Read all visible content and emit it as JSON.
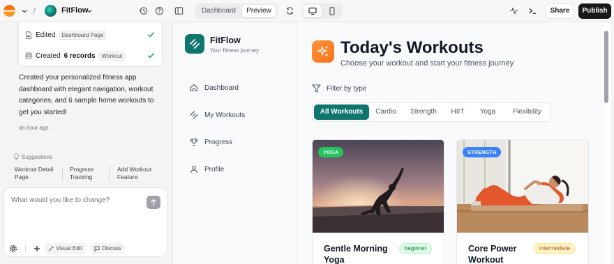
{
  "topbar": {
    "project_name": "FitFlow",
    "view_tabs": [
      "Dashboard",
      "Preview"
    ],
    "active_view": "Preview",
    "share_label": "Share",
    "publish_label": "Publish"
  },
  "chat": {
    "tasks": [
      {
        "verb": "Edited",
        "bold": "",
        "tag": "Dashboard Page"
      },
      {
        "verb": "Created",
        "bold": "6 records",
        "tag": "Workout"
      }
    ],
    "message": "Created your personalized fitness app dashboard with elegant navigation, workout categories, and 6 sample home workouts to get you started!",
    "time": "an hour ago",
    "suggestions_label": "Suggestions",
    "suggestions": [
      "Workout Detail Page",
      "Progress Tracking",
      "Add Workout Feature"
    ],
    "input_placeholder": "What would you like to change?",
    "visual_edit_label": "Visual Edit",
    "discuss_label": "Discuss"
  },
  "app": {
    "brand": "FitFlow",
    "tagline": "Your fitness journey",
    "nav": [
      "Dashboard",
      "My Workouts",
      "Progress",
      "Profile"
    ],
    "title": "Today's Workouts",
    "subtitle": "Choose your workout and start your fitness journey",
    "filter_label": "Filter by type",
    "tabs": [
      "All Workouts",
      "Cardio",
      "Strength",
      "HIIT",
      "Yoga",
      "Flexibility"
    ],
    "active_tab": "All Workouts",
    "cards": [
      {
        "badge": "YOGA",
        "title": "Gentle Morning Yoga",
        "level": "beginner",
        "badge_color": "#22c55e"
      },
      {
        "badge": "STRENGTH",
        "title": "Core Power Workout",
        "level": "intermediate",
        "badge_color": "#3b82f6"
      }
    ]
  },
  "colors": {
    "accent": "#0f766e",
    "hero_orange": "#f97316",
    "beginner_bg": "#dcfce7",
    "intermediate_bg": "#fef3c7"
  }
}
